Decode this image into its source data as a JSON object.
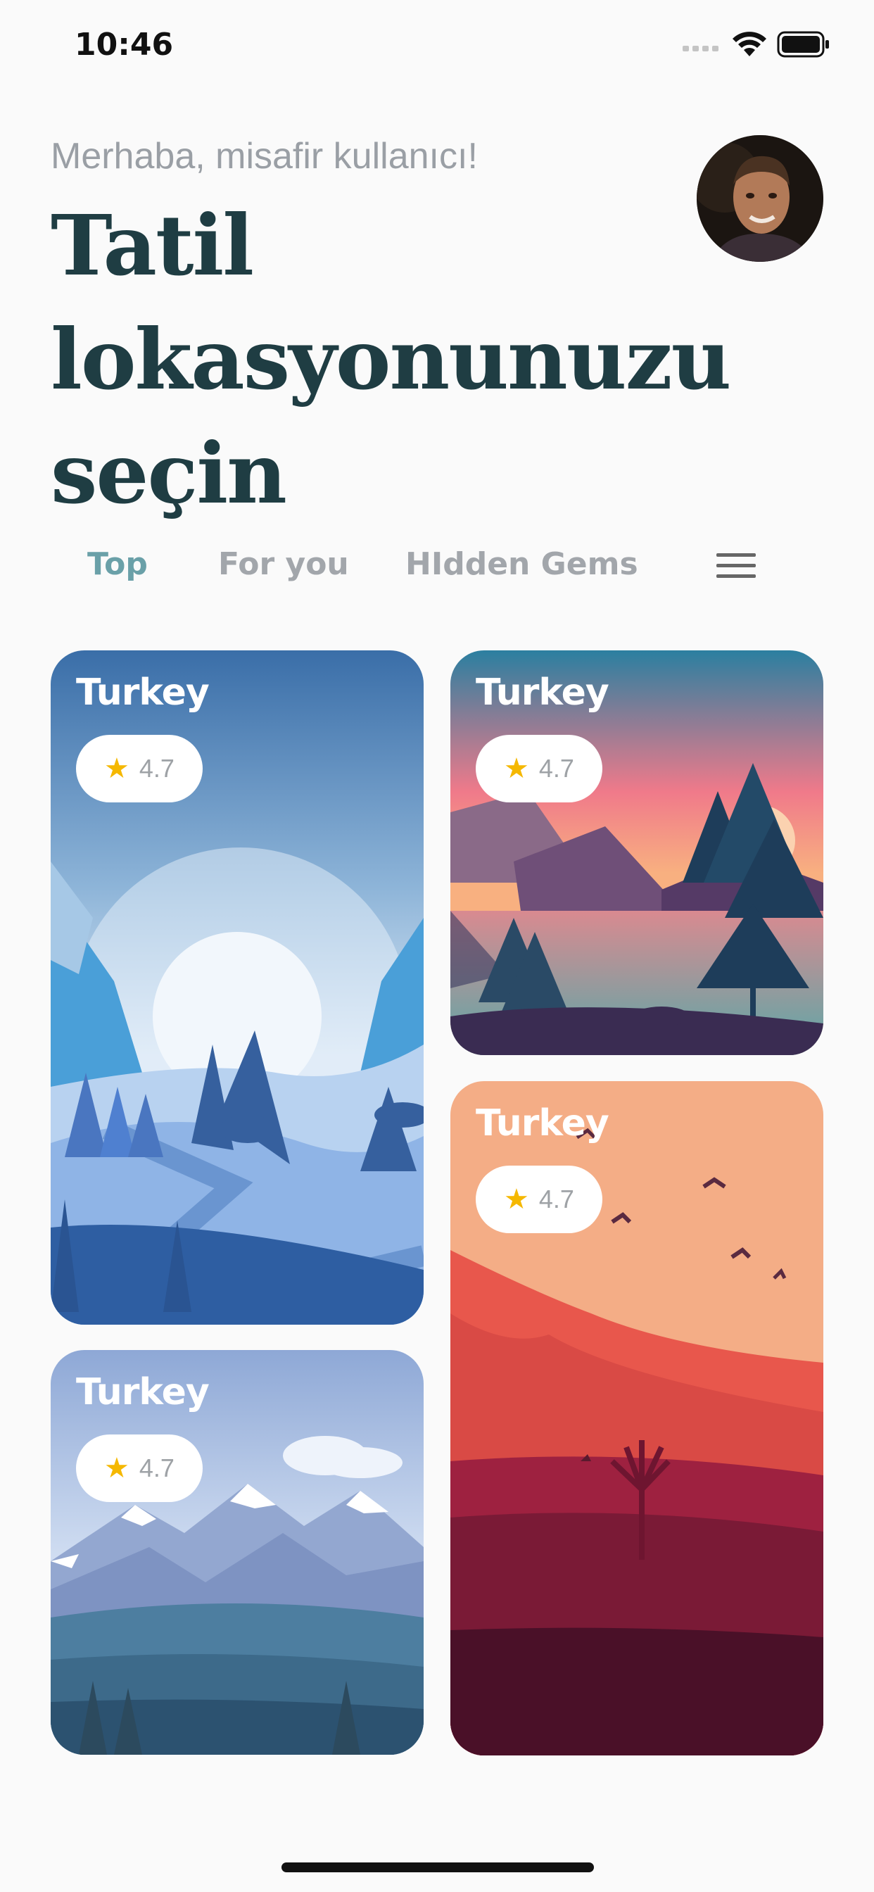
{
  "status_bar": {
    "time": "10:46"
  },
  "header": {
    "greeting": "Merhaba, misafir kullanıcı!",
    "title_lines": [
      "Tatil",
      "lokasyonunuzu",
      "seçin"
    ]
  },
  "tabs": [
    {
      "label": "Top",
      "active": true
    },
    {
      "label": "For you",
      "active": false
    },
    {
      "label": "HIdden Gems",
      "active": false
    }
  ],
  "cards": [
    {
      "title": "Turkey",
      "rating": "4.7",
      "scene": "winter-valley"
    },
    {
      "title": "Turkey",
      "rating": "4.7",
      "scene": "sunset-lake"
    },
    {
      "title": "Turkey",
      "rating": "4.7",
      "scene": "snowy-mountains"
    },
    {
      "title": "Turkey",
      "rating": "4.7",
      "scene": "red-desert"
    }
  ],
  "colors": {
    "accent": "#6aa0a8",
    "title": "#1f3d43",
    "muted": "#a2a6ab",
    "star": "#f5b800"
  },
  "icons": {
    "menu": "hamburger-icon",
    "rating": "star-icon"
  }
}
